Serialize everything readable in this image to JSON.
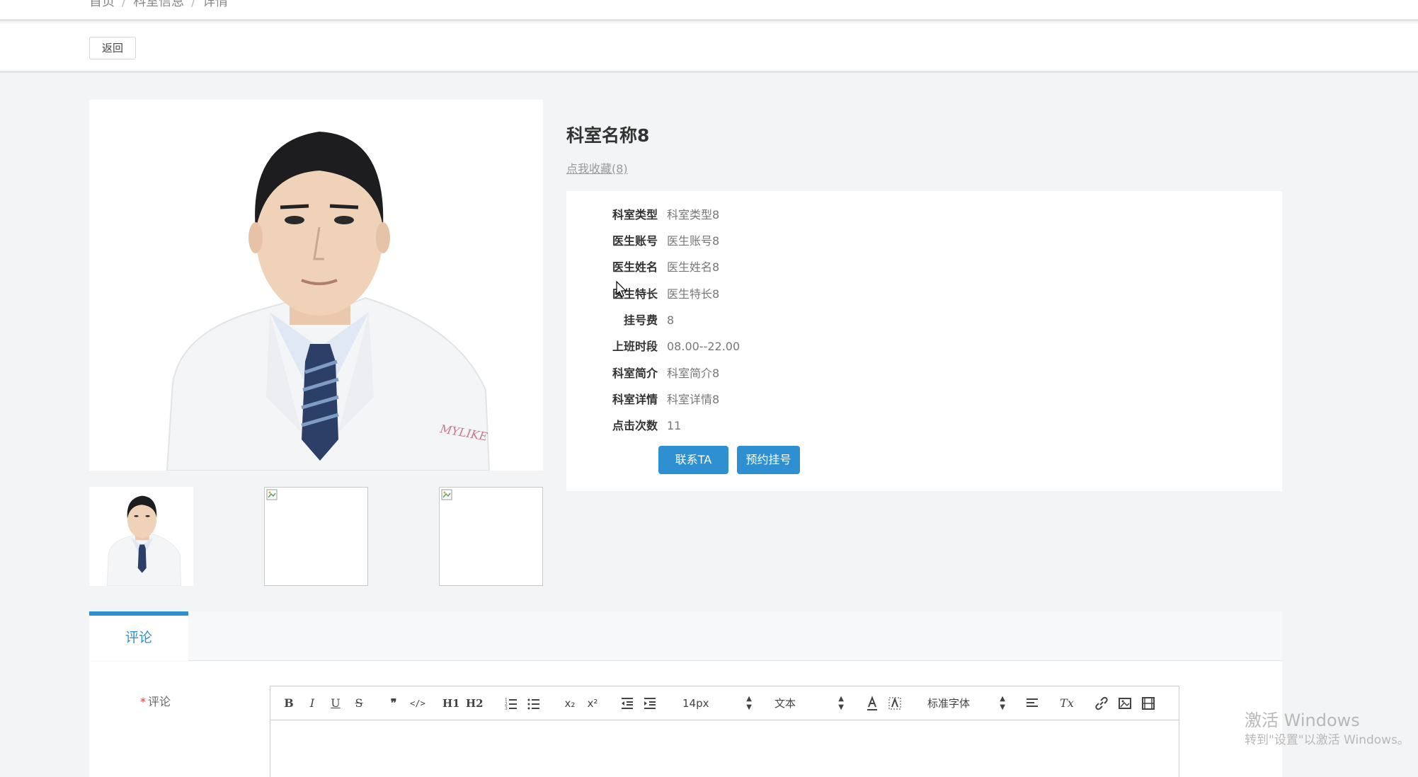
{
  "breadcrumb": {
    "home": "首页",
    "section": "科室信息",
    "current": "详情"
  },
  "back_button": "返回",
  "department": {
    "title": "科室名称8",
    "favorite_link": "点我收藏(8)",
    "fields": [
      {
        "label": "科室类型",
        "value": "科室类型8"
      },
      {
        "label": "医生账号",
        "value": "医生账号8"
      },
      {
        "label": "医生姓名",
        "value": "医生姓名8"
      },
      {
        "label": "医生特长",
        "value": "医生特长8"
      },
      {
        "label": "挂号费",
        "value": "8"
      },
      {
        "label": "上班时段",
        "value": "08.00--22.00"
      },
      {
        "label": "科室简介",
        "value": "科室简介8"
      },
      {
        "label": "科室详情",
        "value": "科室详情8"
      },
      {
        "label": "点击次数",
        "value": "11"
      }
    ],
    "contact_button": "联系TA",
    "book_button": "预约挂号"
  },
  "photo": {
    "coat_logo": "MYLIKE"
  },
  "tabs": {
    "comment_tab": "评论"
  },
  "comment_form": {
    "label": "评论",
    "required_mark": "*",
    "toolbar": {
      "bold": "B",
      "italic": "I",
      "underline": "U",
      "strike": "S",
      "blockquote": "❞",
      "code": "</>",
      "h1": "H1",
      "h2": "H2",
      "subscript": "x₂",
      "superscript": "x²",
      "size": "14px",
      "header_select": "文本",
      "font_select": "标准字体",
      "clear_format": "Tx"
    }
  },
  "watermark": {
    "title": "激活 Windows",
    "subtitle": "转到\"设置\"以激活 Windows。"
  },
  "colors": {
    "primary": "#2e8fd1",
    "page_bg": "#f3f4f5"
  }
}
